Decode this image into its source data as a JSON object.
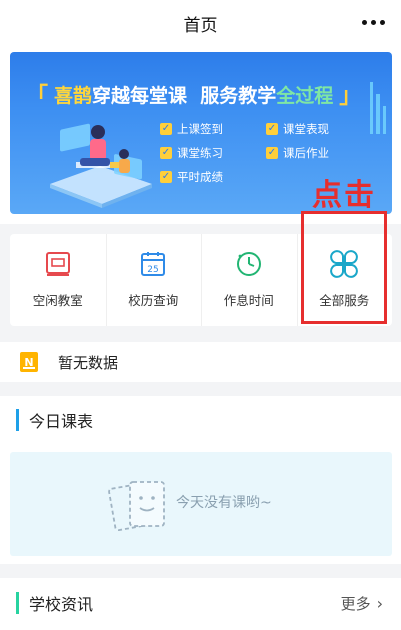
{
  "nav": {
    "title": "首页",
    "more_icon": "more-dots-icon"
  },
  "banner": {
    "bracket_left": "「",
    "bracket_right": "」",
    "part1": "喜鹊",
    "part2": "穿越每堂课  服务教学",
    "part3": "全过程",
    "features": [
      "上课签到",
      "课堂表现",
      "课堂练习",
      "课后作业",
      "平时成绩"
    ],
    "check_glyph": "✓"
  },
  "overlay": {
    "click_tip": "点击"
  },
  "services": [
    {
      "label": "空闲教室",
      "icon": "classroom-icon"
    },
    {
      "label": "校历查询",
      "icon": "calendar-icon",
      "calendar_day": "25"
    },
    {
      "label": "作息时间",
      "icon": "clock-icon"
    },
    {
      "label": "全部服务",
      "icon": "all-services-icon"
    }
  ],
  "notice": {
    "icon_letter": "N",
    "text": "暂无数据"
  },
  "today": {
    "title": "今日课表",
    "empty_text": "今天没有课哟~"
  },
  "news": {
    "title": "学校资讯",
    "more": "更多",
    "chevron": "›"
  },
  "colors": {
    "accent_blue": "#1ea0e8",
    "accent_green": "#27d3a0",
    "highlight_red": "#e62e2e",
    "service_red": "#e6494e",
    "service_blue": "#2f8be8",
    "service_green": "#22b573",
    "service_cyan": "#1aa7c9"
  }
}
